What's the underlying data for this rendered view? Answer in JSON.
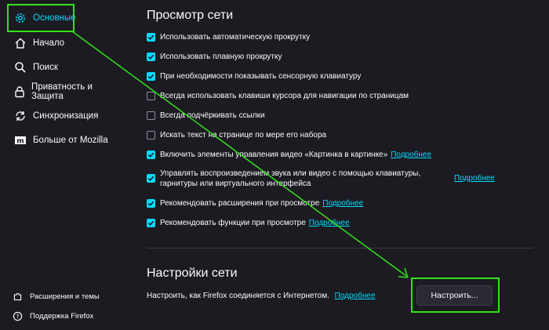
{
  "sidebar": {
    "items": [
      {
        "label": "Основные",
        "icon": "gear-icon"
      },
      {
        "label": "Начало",
        "icon": "home-icon"
      },
      {
        "label": "Поиск",
        "icon": "search-icon"
      },
      {
        "label": "Приватность и Защита",
        "icon": "lock-icon"
      },
      {
        "label": "Синхронизация",
        "icon": "sync-icon"
      },
      {
        "label": "Больше от Mozilla",
        "icon": "mozilla-icon"
      }
    ],
    "footer": [
      {
        "label": "Расширения и темы",
        "icon": "puzzle-icon"
      },
      {
        "label": "Поддержка Firefox",
        "icon": "help-icon"
      }
    ]
  },
  "browsing": {
    "title": "Просмотр сети",
    "options": [
      {
        "label": "Использовать автоматическую прокрутку",
        "checked": true
      },
      {
        "label": "Использовать плавную прокрутку",
        "checked": true
      },
      {
        "label": "При необходимости показывать сенсорную клавиатуру",
        "checked": true
      },
      {
        "label": "Всегда использовать клавиши курсора для навигации по страницам",
        "checked": false
      },
      {
        "label": "Всегда подчёркивать ссылки",
        "checked": false
      },
      {
        "label": "Искать текст на странице по мере его набора",
        "checked": false
      },
      {
        "label": "Включить элементы управления видео «Картинка в картинке»",
        "checked": true,
        "link": "Подробнее"
      },
      {
        "label": "Управлять воспроизведением звука или видео с помощью клавиатуры,",
        "label2": "гарнитуры или виртуального интерфейса",
        "checked": true,
        "link": "Подробнее"
      },
      {
        "label": "Рекомендовать расширения при просмотре",
        "checked": true,
        "link": "Подробнее"
      },
      {
        "label": "Рекомендовать функции при просмотре",
        "checked": true,
        "link": "Подробнее"
      }
    ]
  },
  "network": {
    "title": "Настройки сети",
    "description": "Настроить, как Firefox соединяется с Интернетом.",
    "link": "Подробнее",
    "button": "Настроить..."
  },
  "colors": {
    "background": "#1c1b22",
    "accent": "#00ddff",
    "highlight": "#32e21a"
  }
}
